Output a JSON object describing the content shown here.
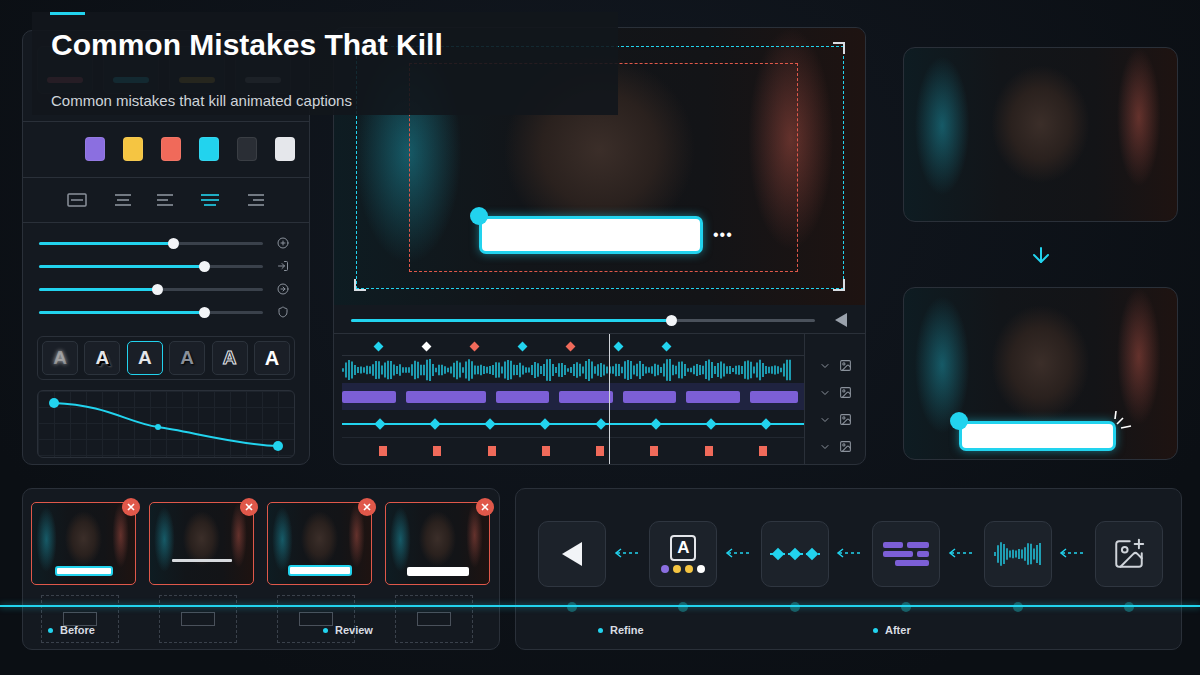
{
  "header": {
    "title": "Common Mistakes That Kill",
    "subtitle": "Common mistakes that kill animated captions"
  },
  "presets": [
    {
      "color": "#e0607a"
    },
    {
      "color": "#22d3ee"
    },
    {
      "color": "#d9b23a"
    },
    {
      "color": "#7d838c"
    }
  ],
  "swatches": [
    {
      "color": "#8b6fe0"
    },
    {
      "color": "#f5c542"
    },
    {
      "color": "#f06a5a"
    },
    {
      "color": "#22d3ee"
    },
    {
      "color": "#2a2e35"
    },
    {
      "color": "#e5e7eb"
    }
  ],
  "alignments": [
    {
      "kind": "box",
      "selected": false
    },
    {
      "kind": "center",
      "selected": false
    },
    {
      "kind": "left",
      "selected": false
    },
    {
      "kind": "justify",
      "selected": true
    },
    {
      "kind": "right",
      "selected": false
    }
  ],
  "sliders": [
    {
      "level": 0.6
    },
    {
      "level": 0.74
    },
    {
      "level": 0.53
    },
    {
      "level": 0.74
    }
  ],
  "font_styles": [
    {
      "label": "A",
      "kind": "blur",
      "selected": false
    },
    {
      "label": "A",
      "kind": "shadow",
      "selected": false
    },
    {
      "label": "A",
      "kind": "solid",
      "selected": true
    },
    {
      "label": "A",
      "kind": "faded",
      "selected": false
    },
    {
      "label": "A",
      "kind": "outline",
      "selected": false
    },
    {
      "label": "A",
      "kind": "bold",
      "selected": false
    }
  ],
  "preview": {
    "caption_menu": "•••"
  },
  "scrubber": {
    "level": 0.69
  },
  "markers": [
    {
      "color": "#22d3ee"
    },
    {
      "color": "#ffffff"
    },
    {
      "color": "#f06a5a"
    },
    {
      "color": "#22d3ee"
    },
    {
      "color": "#f06a5a"
    },
    {
      "color": "#22d3ee"
    },
    {
      "color": "#22d3ee"
    }
  ],
  "tracks": [
    {
      "kind": "audio"
    },
    {
      "kind": "captions"
    },
    {
      "kind": "keyframes"
    },
    {
      "kind": "cues"
    }
  ],
  "mistakes": [
    {
      "kind": "glow",
      "flagged": true
    },
    {
      "kind": "plain-text",
      "flagged": true
    },
    {
      "kind": "outline",
      "flagged": true
    },
    {
      "kind": "bar",
      "flagged": true
    }
  ],
  "pipeline": [
    {
      "kind": "play"
    },
    {
      "kind": "style",
      "label": "A",
      "dots": [
        "#8b6fe0",
        "#f5c542",
        "#f5c542",
        "#ffffff"
      ]
    },
    {
      "kind": "keyframes"
    },
    {
      "kind": "text"
    },
    {
      "kind": "audio"
    },
    {
      "kind": "media"
    }
  ],
  "stages": [
    {
      "label": "Before"
    },
    {
      "label": "Review"
    },
    {
      "label": "Refine"
    },
    {
      "label": "After"
    }
  ]
}
